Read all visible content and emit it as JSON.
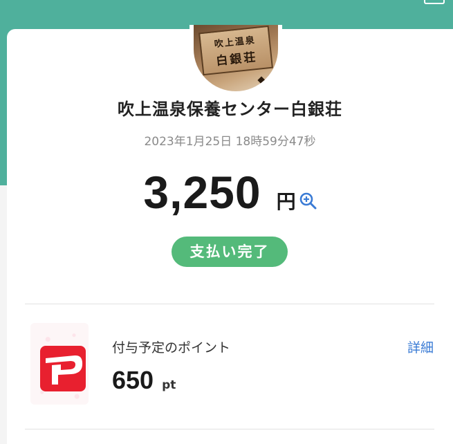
{
  "store": {
    "name": "吹上温泉保養センター白銀荘",
    "sign_top": "吹上温泉",
    "sign_bottom": "白銀荘"
  },
  "payment": {
    "datetime": "2023年1月25日 18時59分47秒",
    "amount": "3,250",
    "currency": "円",
    "status": "支払い完了"
  },
  "points": {
    "label": "付与予定のポイント",
    "value": "650",
    "unit": "pt",
    "detail_link": "詳細"
  },
  "icons": {
    "zoom": "zoom-in-icon",
    "paypay": "paypay-logo-icon"
  },
  "colors": {
    "header": "#4fb09c",
    "status_badge": "#54ba7a",
    "link": "#3a7bd5",
    "paypay_red": "#e8202f"
  }
}
